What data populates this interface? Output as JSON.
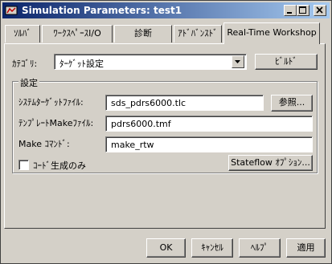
{
  "window": {
    "title": "Simulation Parameters: test1",
    "minimize_label": "_",
    "maximize_label": "□",
    "close_label": "×"
  },
  "tabs": [
    {
      "label": "ｿﾙﾊﾞ"
    },
    {
      "label": "ﾜｰｸｽﾍﾟｰｽI/O"
    },
    {
      "label": "診断"
    },
    {
      "label": "ｱﾄﾞﾊﾞﾝｽﾄﾞ"
    },
    {
      "label": "Real-Time Workshop"
    }
  ],
  "category": {
    "label": "ｶﾃｺﾞﾘ:",
    "value": "ﾀｰｹﾞｯﾄ設定",
    "build_button": "ﾋﾞﾙﾄﾞ"
  },
  "settings": {
    "group_title": "設定",
    "system_target_label": "ｼｽﾃﾑﾀｰｹﾞｯﾄﾌｧｲﾙ:",
    "system_target_value": "sds_pdrs6000.tlc",
    "browse_button": "参照...",
    "template_make_label": "ﾃﾝﾌﾟﾚｰﾄMakeﾌｧｲﾙ:",
    "template_make_value": "pdrs6000.tmf",
    "make_command_label": "Make ｺﾏﾝﾄﾞ:",
    "make_command_value": "make_rtw",
    "generate_code_only_label": "ｺｰﾄﾞ生成のみ",
    "generate_code_only_checked": false,
    "stateflow_button": "Stateflow ｵﾌﾟｼｮﾝ..."
  },
  "footer": {
    "ok": "OK",
    "cancel": "ｷｬﾝｾﾙ",
    "help": "ﾍﾙﾌﾟ",
    "apply": "適用"
  }
}
